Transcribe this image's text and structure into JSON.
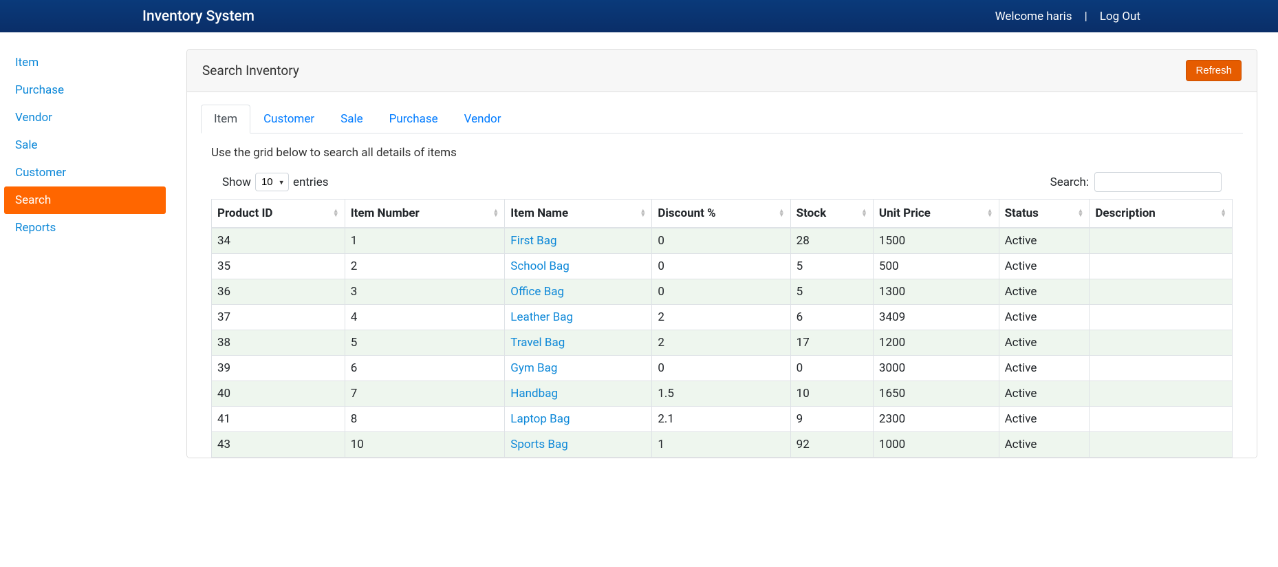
{
  "navbar": {
    "brand": "Inventory System",
    "welcome": "Welcome haris",
    "divider": "|",
    "logout": "Log Out"
  },
  "sidebar": {
    "items": [
      {
        "label": "Item",
        "active": false
      },
      {
        "label": "Purchase",
        "active": false
      },
      {
        "label": "Vendor",
        "active": false
      },
      {
        "label": "Sale",
        "active": false
      },
      {
        "label": "Customer",
        "active": false
      },
      {
        "label": "Search",
        "active": true
      },
      {
        "label": "Reports",
        "active": false
      }
    ]
  },
  "panel": {
    "title": "Search Inventory",
    "refresh": "Refresh"
  },
  "tabs": [
    {
      "label": "Item",
      "active": true
    },
    {
      "label": "Customer",
      "active": false
    },
    {
      "label": "Sale",
      "active": false
    },
    {
      "label": "Purchase",
      "active": false
    },
    {
      "label": "Vendor",
      "active": false
    }
  ],
  "grid_instruction": "Use the grid below to search all details of items",
  "table_controls": {
    "show_prefix": "Show",
    "show_suffix": "entries",
    "page_size": "10",
    "search_label": "Search:"
  },
  "table": {
    "columns": [
      "Product ID",
      "Item Number",
      "Item Name",
      "Discount %",
      "Stock",
      "Unit Price",
      "Status",
      "Description"
    ],
    "rows": [
      {
        "product_id": "34",
        "item_number": "1",
        "item_name": "First Bag",
        "discount": "0",
        "stock": "28",
        "unit_price": "1500",
        "status": "Active",
        "description": ""
      },
      {
        "product_id": "35",
        "item_number": "2",
        "item_name": "School Bag",
        "discount": "0",
        "stock": "5",
        "unit_price": "500",
        "status": "Active",
        "description": ""
      },
      {
        "product_id": "36",
        "item_number": "3",
        "item_name": "Office Bag",
        "discount": "0",
        "stock": "5",
        "unit_price": "1300",
        "status": "Active",
        "description": ""
      },
      {
        "product_id": "37",
        "item_number": "4",
        "item_name": "Leather Bag",
        "discount": "2",
        "stock": "6",
        "unit_price": "3409",
        "status": "Active",
        "description": ""
      },
      {
        "product_id": "38",
        "item_number": "5",
        "item_name": "Travel Bag",
        "discount": "2",
        "stock": "17",
        "unit_price": "1200",
        "status": "Active",
        "description": ""
      },
      {
        "product_id": "39",
        "item_number": "6",
        "item_name": "Gym Bag",
        "discount": "0",
        "stock": "0",
        "unit_price": "3000",
        "status": "Active",
        "description": ""
      },
      {
        "product_id": "40",
        "item_number": "7",
        "item_name": "Handbag",
        "discount": "1.5",
        "stock": "10",
        "unit_price": "1650",
        "status": "Active",
        "description": ""
      },
      {
        "product_id": "41",
        "item_number": "8",
        "item_name": "Laptop Bag",
        "discount": "2.1",
        "stock": "9",
        "unit_price": "2300",
        "status": "Active",
        "description": ""
      },
      {
        "product_id": "43",
        "item_number": "10",
        "item_name": "Sports Bag",
        "discount": "1",
        "stock": "92",
        "unit_price": "1000",
        "status": "Active",
        "description": ""
      }
    ]
  }
}
